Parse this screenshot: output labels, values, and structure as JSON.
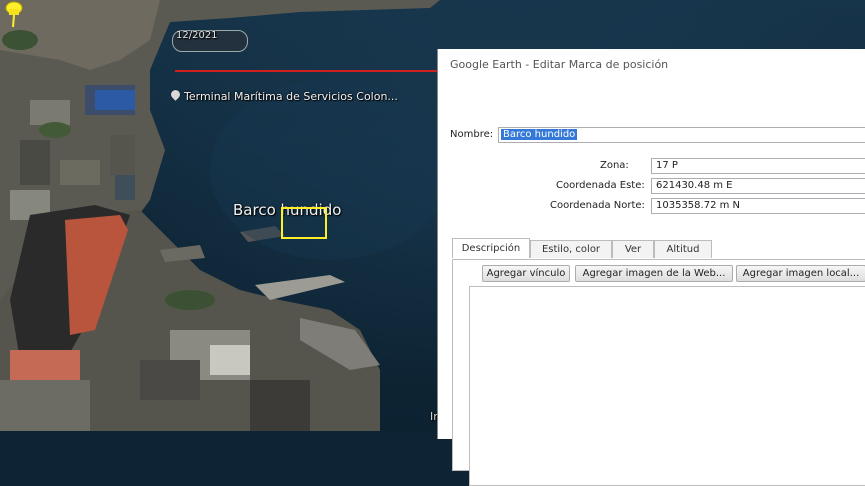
{
  "map": {
    "date": "12/2021",
    "terminal_label": "Terminal Marítima de Servicios Colon...",
    "placemark_label": "Barco hundido",
    "partial_label": "In"
  },
  "dialog": {
    "title": "Google Earth - Editar Marca de posición",
    "name_label": "Nombre:",
    "name_value": "Barco hundido",
    "zona_label": "Zona:",
    "zona_value": "17 P",
    "este_label": "Coordenada Este:",
    "este_value": "621430.48 m E",
    "norte_label": "Coordenada Norte:",
    "norte_value": "1035358.72 m N",
    "tabs": [
      {
        "label": "Descripción",
        "active": true
      },
      {
        "label": "Estilo, color",
        "active": false
      },
      {
        "label": "Ver",
        "active": false
      },
      {
        "label": "Altitud",
        "active": false
      }
    ],
    "buttons": {
      "add_link": "Agregar vínculo",
      "add_web_image": "Agregar imagen de la Web...",
      "add_local_image": "Agregar imagen local..."
    },
    "description_value": ""
  },
  "colors": {
    "placemark": "#ffef2a",
    "selection": "#3478d8",
    "water": "#12303f",
    "tour_line": "#d11f1f"
  },
  "icons": [
    "pushpin-icon",
    "location-pin-icon"
  ]
}
